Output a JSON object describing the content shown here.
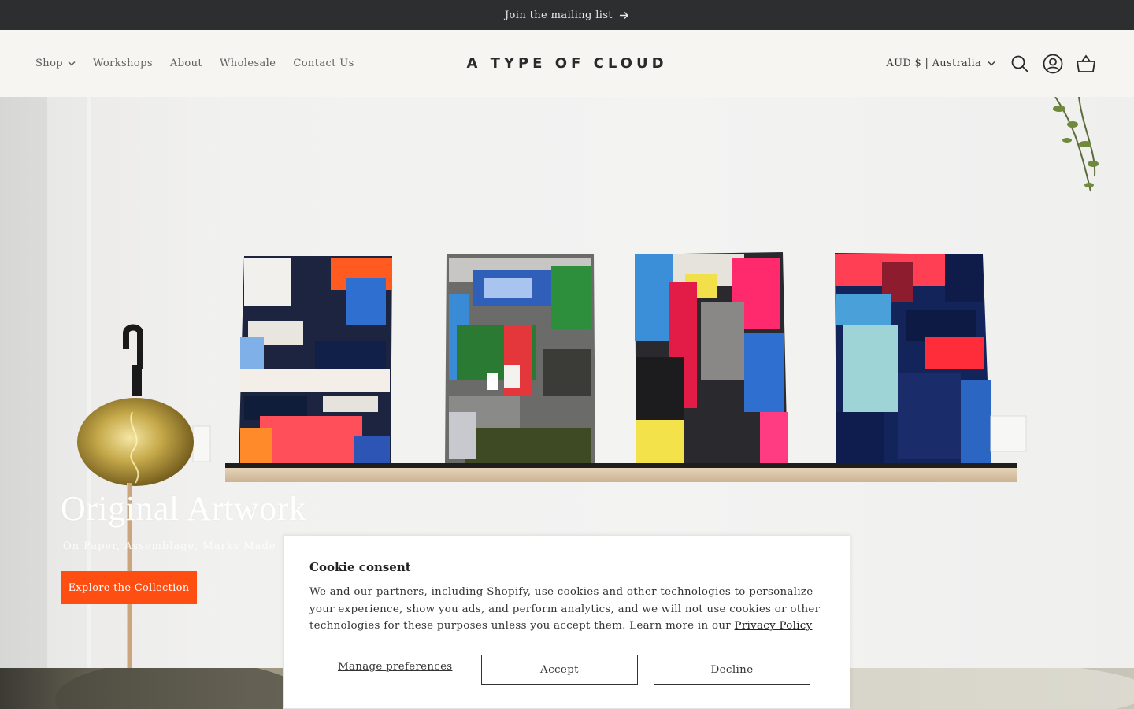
{
  "announcement": {
    "text": "Join the mailing list",
    "icon": "arrow-right-icon"
  },
  "nav": {
    "items": [
      {
        "label": "Shop",
        "has_dropdown": true
      },
      {
        "label": "Workshops"
      },
      {
        "label": "About"
      },
      {
        "label": "Wholesale"
      },
      {
        "label": "Contact Us"
      }
    ]
  },
  "logo": {
    "text": "A TYPE OF CLOUD"
  },
  "header_tools": {
    "currency": "AUD $ | Australia",
    "icons": [
      "search-icon",
      "account-icon",
      "cart-icon"
    ]
  },
  "hero": {
    "title": "Original Artwork",
    "subtitle": "On Paper, Assemblage, Marks Made",
    "button_label": "Explore the Collection",
    "accent_color": "#ff4e12"
  },
  "cookie": {
    "title": "Cookie consent",
    "body": "We and our partners, including Shopify, use cookies and other technologies to personalize your experience, show you ads, and perform analytics, and we will not use cookies or other technologies for these purposes unless you accept them. Learn more in our",
    "link_text": "Privacy Policy",
    "manage_label": "Manage preferences",
    "accept_label": "Accept",
    "decline_label": "Decline"
  }
}
